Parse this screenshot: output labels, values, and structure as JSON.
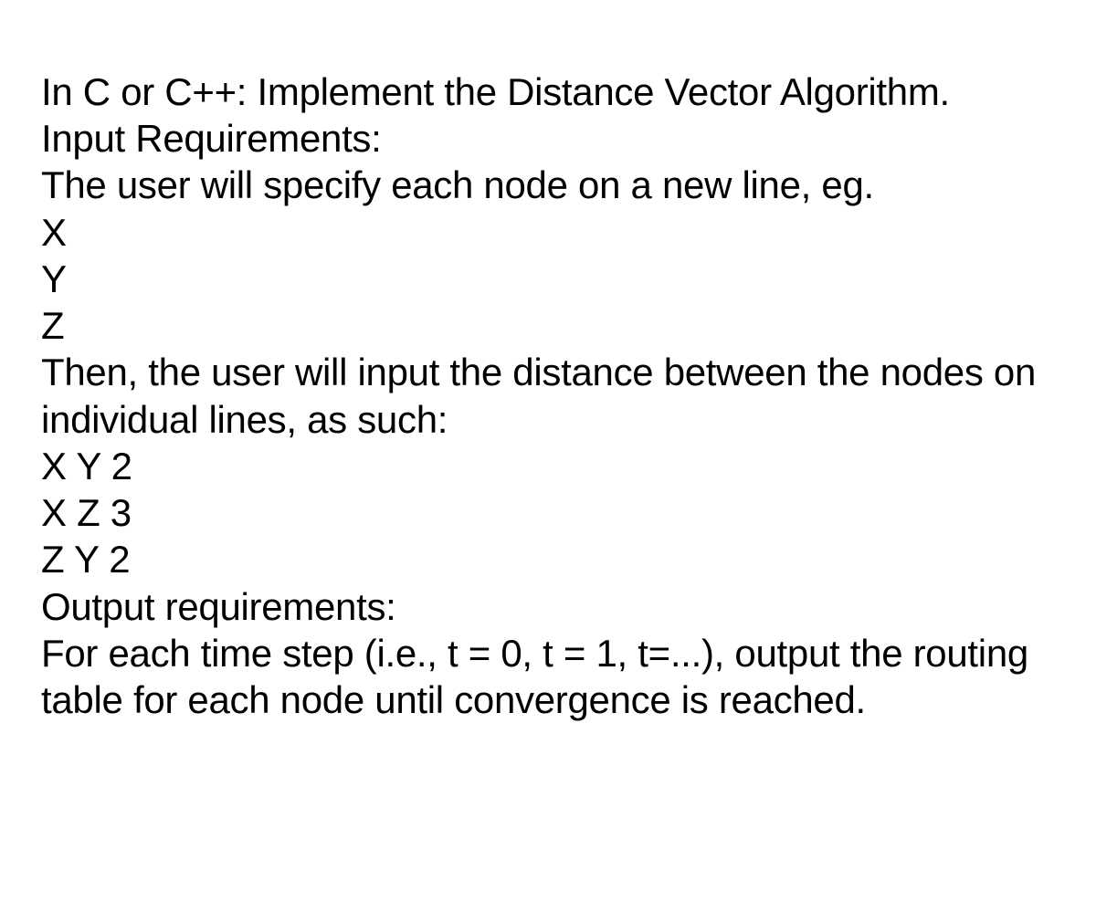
{
  "lines": [
    "In C or C++: Implement the Distance Vector Algorithm.",
    "Input Requirements:",
    "The user will specify each node on a new line, eg.",
    "X",
    "Y",
    "Z",
    "Then, the user will input the distance between the nodes on individual lines, as such:",
    "X Y 2",
    "X Z 3",
    "Z Y 2",
    "Output requirements:",
    "For each time step (i.e., t = 0, t = 1, t=...), output the routing table for each node until convergence is reached."
  ]
}
